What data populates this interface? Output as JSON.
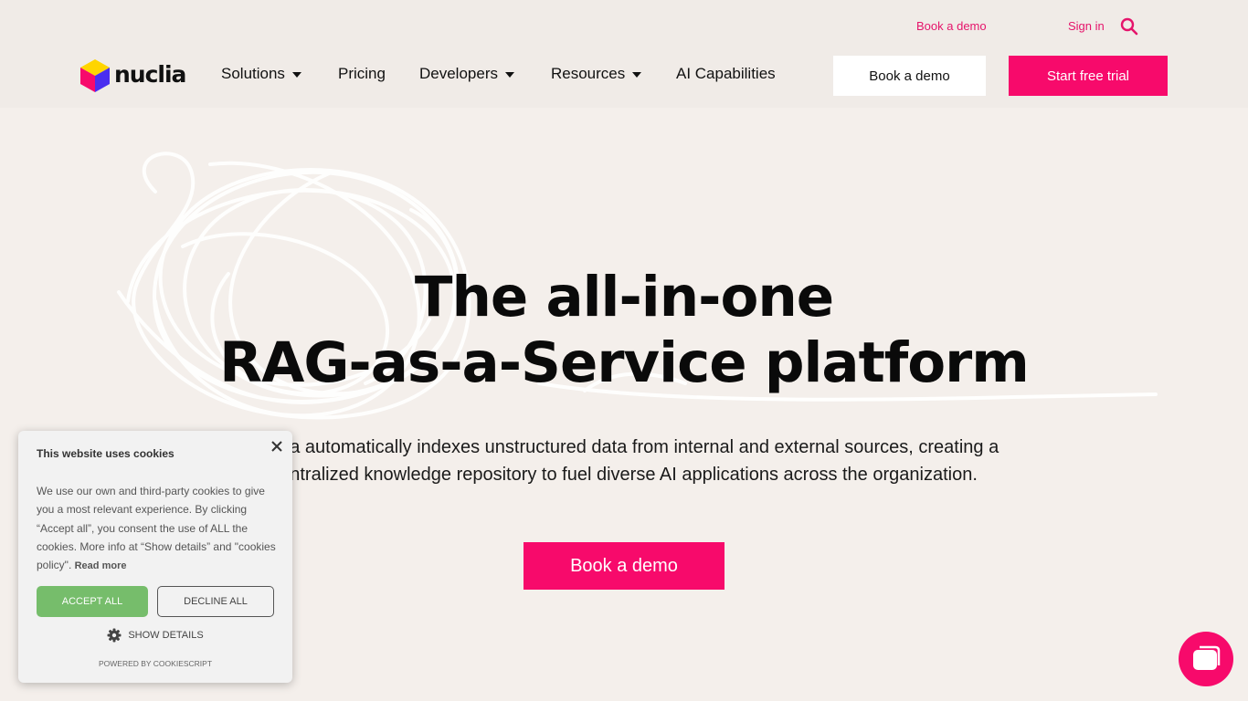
{
  "colors": {
    "brand_pink": "#f70a6b",
    "link_pink": "#e5146b",
    "page_background": "#f4efeb",
    "accept_green": "#76bd6b"
  },
  "utility_nav": {
    "book_demo_label": "Book a demo",
    "sign_in_label": "Sign in",
    "search_icon": "search-icon"
  },
  "logo": {
    "text": "nuclia"
  },
  "nav": {
    "items": [
      {
        "label": "Solutions",
        "has_dropdown": true
      },
      {
        "label": "Pricing",
        "has_dropdown": false
      },
      {
        "label": "Developers",
        "has_dropdown": true
      },
      {
        "label": "Resources",
        "has_dropdown": true
      },
      {
        "label": "AI Capabilities",
        "has_dropdown": false
      }
    ],
    "book_demo_button": "Book a demo",
    "free_trial_button": "Start free trial"
  },
  "hero": {
    "title_line1": "The all-in-one",
    "title_line2": "RAG-as-a-Service platform",
    "subtitle_line1": "Nuclia automatically indexes unstructured data from internal and external sources, creating a",
    "subtitle_line2": "centralized knowledge repository to fuel diverse AI applications across the organization.",
    "cta_label": "Book a demo"
  },
  "cookie_banner": {
    "title": "This website uses cookies",
    "body": "We use our own and third-party cookies to give you a most relevant experience. By clicking “Accept all”, you consent the use of ALL the cookies. More info at “Show details” and \"cookies policy\". ",
    "read_more": "Read more",
    "accept_label": "ACCEPT ALL",
    "decline_label": "DECLINE ALL",
    "details_label": "SHOW DETAILS",
    "powered_by": "POWERED BY COOKIESCRIPT"
  },
  "chat_widget": {
    "icon": "chat-icon"
  }
}
